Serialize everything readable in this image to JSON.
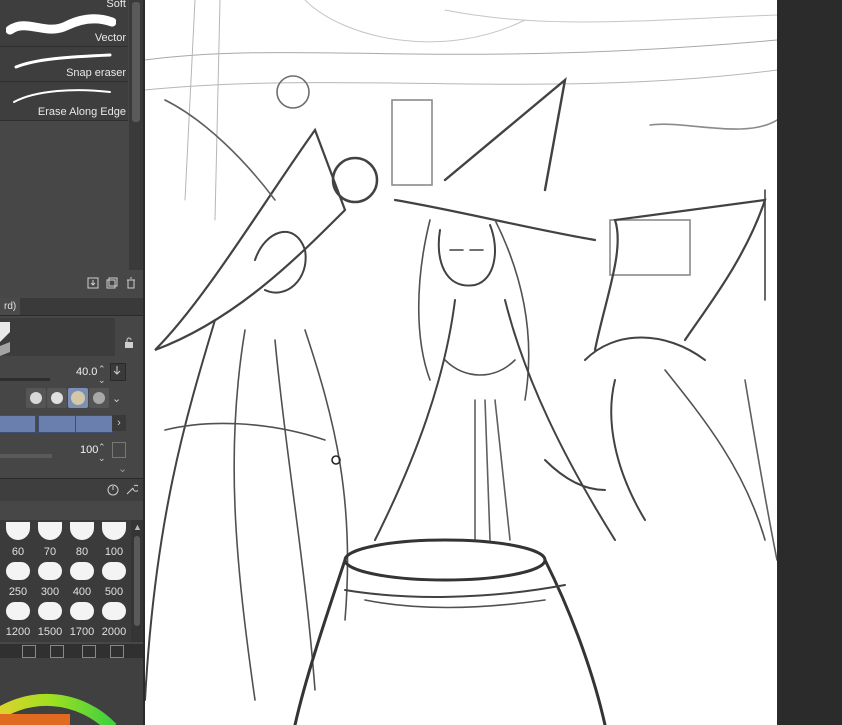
{
  "brushes": [
    {
      "label": "Soft"
    },
    {
      "label": "Vector"
    },
    {
      "label": "Snap eraser"
    },
    {
      "label": "Erase Along Edge"
    }
  ],
  "brush_toolbar": {
    "icons": [
      "export-icon",
      "duplicate-icon",
      "trash-icon"
    ]
  },
  "tool_tab": {
    "label": "rd)"
  },
  "properties": {
    "brush_size_value": "40.0",
    "opacity_value": "100"
  },
  "size_presets": [
    "60",
    "70",
    "80",
    "100",
    "250",
    "300",
    "400",
    "500",
    "1200",
    "1500",
    "1700",
    "2000"
  ],
  "colors": {
    "panel": "#474747",
    "accent_blue": "#6a7fae",
    "canvas": "#ffffff",
    "gutter": "#2b2b2b"
  }
}
